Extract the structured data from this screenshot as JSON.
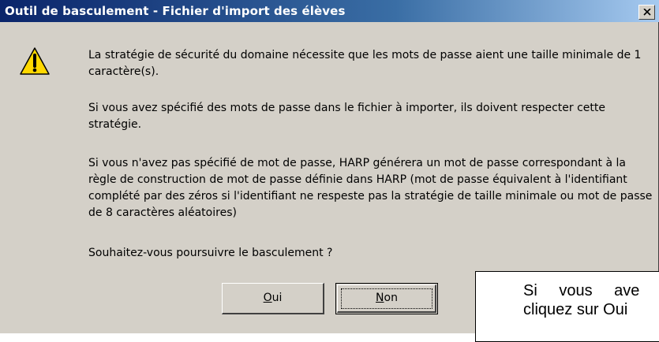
{
  "dialog": {
    "title": "Outil de basculement - Fichier d'import des élèves",
    "icon": "warning-icon",
    "paragraphs": [
      "La stratégie de sécurité du domaine nécessite que les mots de passe aient une taille minimale de 1 caractère(s).",
      "Si vous avez spécifié des mots de passe dans le fichier à importer, ils doivent respecter cette stratégie.",
      "Si vous n'avez pas spécifié de mot de passe, HARP générera un mot de passe correspondant à la règle de construction de mot de passe définie dans HARP (mot de passe équivalent à l'identifiant complété par des zéros si l'identifiant ne respeste pas la stratégie de taille minimale ou mot de passe de 8 caractères aléatoires)",
      "Souhaitez-vous poursuivre le basculement ?"
    ],
    "buttons": {
      "yes": {
        "mnemonic": "O",
        "rest": "ui"
      },
      "no": {
        "mnemonic": "N",
        "rest": "on"
      }
    }
  },
  "overlay_note": {
    "line1": "Si vous ave",
    "line2": "cliquez sur Oui"
  },
  "colors": {
    "title_start": "#0a246a",
    "title_end": "#a6caf0",
    "face": "#d4d0c8",
    "warning_fill": "#ffd800"
  }
}
